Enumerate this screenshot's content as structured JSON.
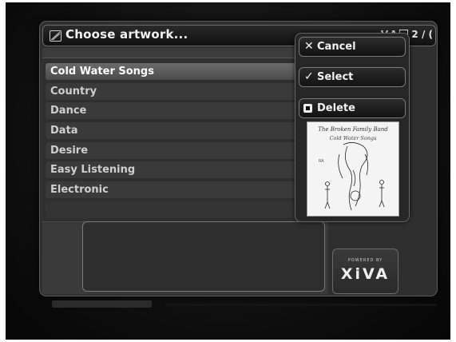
{
  "dialog": {
    "title": "Choose artwork...",
    "pager": "2 / (",
    "nav": {
      "down": "V",
      "up": "Λ"
    }
  },
  "list": {
    "items": [
      {
        "label": "Cold Water Songs",
        "selected": true
      },
      {
        "label": "Country"
      },
      {
        "label": "Dance"
      },
      {
        "label": "Data"
      },
      {
        "label": "Desire"
      },
      {
        "label": "Easy Listening"
      },
      {
        "label": "Electronic"
      }
    ]
  },
  "sidebar": {
    "cancel_label": "Cancel",
    "select_label": "Select",
    "delete_label": "Delete",
    "cancel_icon": "close-icon",
    "select_icon": "checkmark-icon",
    "delete_icon": "stop-square-icon"
  },
  "artwork": {
    "line1": "The Broken Family Band",
    "line2": "Cold Water Songs"
  },
  "branding": {
    "tagline": "POWERED BY",
    "name": "XiVA"
  },
  "colors": {
    "background": "#0b0b0b",
    "dialog": "#2f2f2f",
    "selected_row": "#5a5a5a",
    "text": "#e8e8e8"
  }
}
